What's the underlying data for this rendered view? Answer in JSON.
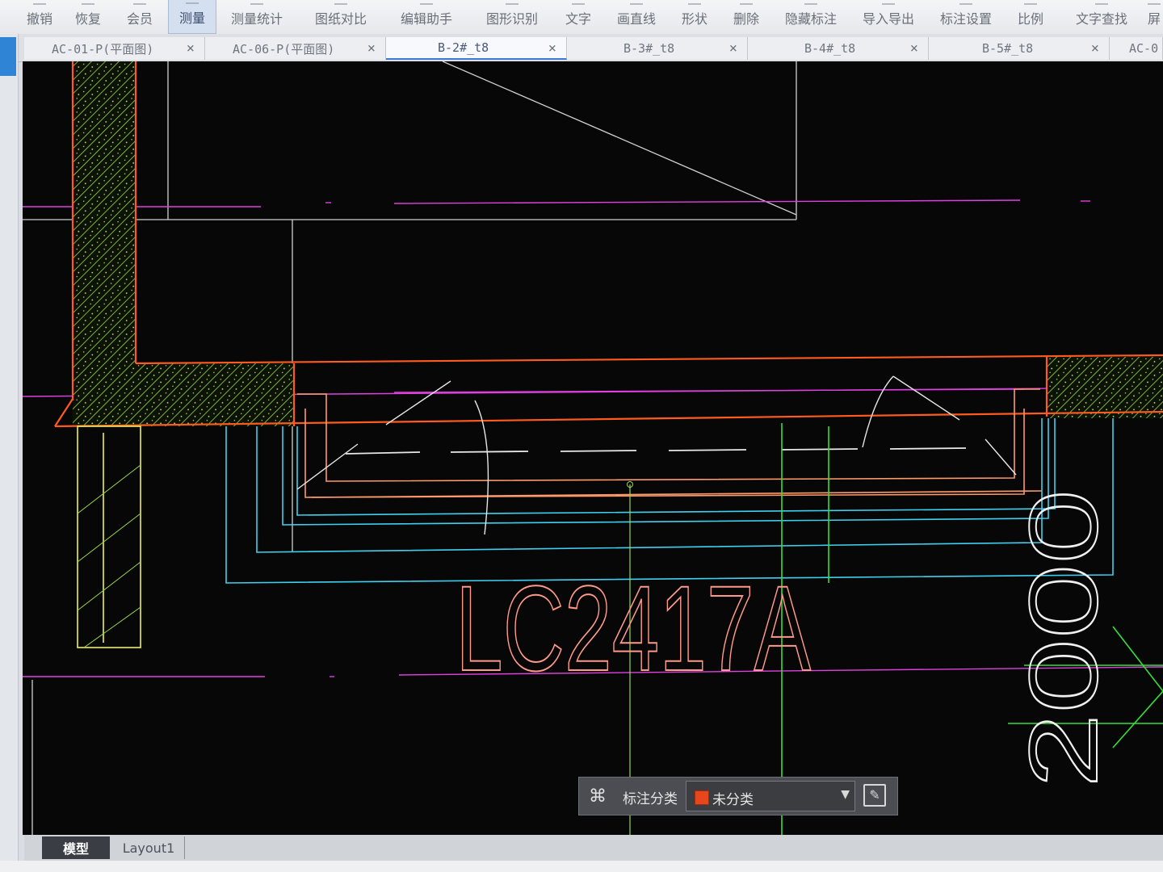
{
  "toolbar": {
    "items": [
      {
        "label": "撤销",
        "icon": "undo-icon"
      },
      {
        "label": "恢复",
        "icon": "redo-icon"
      },
      {
        "label": "会员",
        "icon": "vip-icon"
      },
      {
        "label": "测量",
        "icon": "measure-icon",
        "active": true
      },
      {
        "label": "测量统计",
        "icon": "measure-stats-icon"
      },
      {
        "label": "图纸对比",
        "icon": "compare-icon"
      },
      {
        "label": "编辑助手",
        "icon": "edit-assistant-icon"
      },
      {
        "label": "图形识别",
        "icon": "shape-recognize-icon"
      },
      {
        "label": "文字",
        "icon": "text-icon"
      },
      {
        "label": "画直线",
        "icon": "line-icon"
      },
      {
        "label": "形状",
        "icon": "shape-icon"
      },
      {
        "label": "删除",
        "icon": "delete-icon"
      },
      {
        "label": "隐藏标注",
        "icon": "hide-annotation-icon"
      },
      {
        "label": "导入导出",
        "icon": "import-export-icon"
      },
      {
        "label": "标注设置",
        "icon": "annotation-settings-icon"
      },
      {
        "label": "比例",
        "icon": "scale-icon"
      },
      {
        "label": "文字查找",
        "icon": "text-search-icon"
      },
      {
        "label": "屏",
        "icon": "screen-icon"
      }
    ]
  },
  "tabs": [
    {
      "label": "AC-01-P(平面图)",
      "close": "×"
    },
    {
      "label": "AC-06-P(平面图)",
      "close": "×"
    },
    {
      "label": "B-2#_t8",
      "close": "×",
      "active": true
    },
    {
      "label": "B-3#_t8",
      "close": "×"
    },
    {
      "label": "B-4#_t8",
      "close": "×"
    },
    {
      "label": "B-5#_t8",
      "close": "×"
    },
    {
      "label": "AC-0",
      "close": ""
    }
  ],
  "drawing": {
    "window_tag": "LC2417A",
    "dimension": "2000"
  },
  "annotation_bar": {
    "label": "标注分类",
    "selected": "未分类",
    "swatch_color": "#e8461c"
  },
  "model_tabs": [
    {
      "label": "模型",
      "active": true
    },
    {
      "label": "Layout1",
      "active": false
    }
  ],
  "colors": {
    "canvas": "#070707",
    "orange": "#ff5a1f",
    "magenta": "#e040e0",
    "cyan": "#3fd0f0",
    "green": "#36e03a",
    "yellow": "#f2f24a",
    "hatch": "#9ad84a",
    "white": "#d8d8d8",
    "text_pink": "#ff9a8a"
  }
}
